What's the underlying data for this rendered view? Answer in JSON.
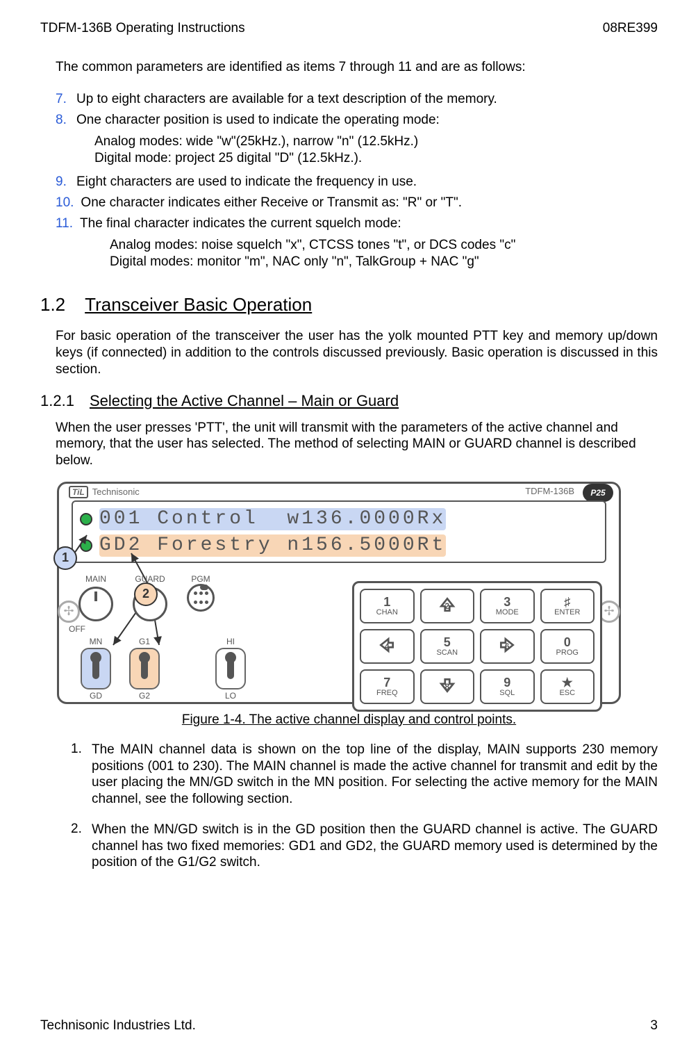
{
  "header": {
    "left": "TDFM-136B Operating Instructions",
    "right": "08RE399"
  },
  "intro": "The common parameters are identified as items 7 through 11 and are as follows:",
  "params": [
    {
      "num": "7.",
      "text": "Up to eight characters are available for a text description of the memory."
    },
    {
      "num": "8.",
      "text": "One character position is used to indicate the operating mode:"
    }
  ],
  "params8_sub": {
    "l1": "Analog modes: wide \"w\"(25kHz.), narrow \"n\" (12.5kHz.)",
    "l2": "Digital mode: project 25 digital \"D\" (12.5kHz.)."
  },
  "params_b": [
    {
      "num": "9.",
      "text": "Eight characters are used to indicate the frequency in use."
    },
    {
      "num": "10.",
      "text": "One character indicates either Receive or Transmit as: \"R\" or \"T\"."
    },
    {
      "num": "11.",
      "text": "The final character indicates the current squelch mode:"
    }
  ],
  "params11_sub": {
    "l1": "Analog modes:  noise squelch \"x\", CTCSS tones \"t\", or DCS codes \"c\"",
    "l2": "Digital modes:   monitor \"m\", NAC only \"n\", TalkGroup + NAC \"g\""
  },
  "sec12": {
    "num": "1.2",
    "title": "Transceiver Basic Operation"
  },
  "sec12_para": "For basic operation of the transceiver the user has the yolk mounted PTT key and memory up/down keys (if connected) in addition to the controls discussed previously. Basic operation is discussed in this section.",
  "sec121": {
    "num": "1.2.1",
    "title": "Selecting the Active Channel – Main or Guard"
  },
  "sec121_para": "When the user presses 'PTT', the unit will transmit with the parameters of the active channel and memory, that the user has selected. The method of selecting MAIN or GUARD channel is described below.",
  "figure_caption": "Figure 1-4. The active channel display and control points.",
  "steps": [
    {
      "num": "1.",
      "text": "The MAIN channel data is shown on the top line of the display, MAIN supports 230 memory positions (001 to 230).  The MAIN channel is made the active channel for transmit and edit by the user placing the MN/GD switch in the MN position.  For selecting the active memory for the MAIN channel, see the following section."
    },
    {
      "num": "2.",
      "text": "When the MN/GD switch is in the GD position then the GUARD channel is active.  The GUARD channel has two fixed memories: GD1 and GD2, the GUARD memory used is determined by the position of the G1/G2 switch."
    }
  ],
  "footer": {
    "left": "Technisonic Industries Ltd.",
    "right": "3"
  },
  "panel": {
    "brand": "Technisonic",
    "model": "TDFM-136B",
    "p25": "P25",
    "lcd_line1": "001 Control  w136.0000Rx",
    "lcd_line2": "GD2 Forestry n156.5000Rt",
    "labels": {
      "main": "MAIN",
      "guard": "GUARD",
      "off": "OFF",
      "pgm": "PGM",
      "mn": "MN",
      "gd": "GD",
      "g1": "G1",
      "g2": "G2",
      "hi": "HI",
      "lo": "LO"
    },
    "callouts": {
      "c1": "1",
      "c2": "2"
    },
    "keys": [
      {
        "big": "1",
        "small": "CHAN"
      },
      {
        "arrow": "up",
        "big": "2"
      },
      {
        "big": "3",
        "small": "MODE"
      },
      {
        "big": "♯",
        "small": "ENTER"
      },
      {
        "arrow": "left",
        "big": "4"
      },
      {
        "big": "5",
        "small": "SCAN"
      },
      {
        "arrow": "right",
        "big": "6"
      },
      {
        "big": "0",
        "small": "PROG"
      },
      {
        "big": "7",
        "small": "FREQ"
      },
      {
        "arrow": "down",
        "big": "8"
      },
      {
        "big": "9",
        "small": "SQL"
      },
      {
        "big": "★",
        "small": "ESC"
      }
    ]
  }
}
